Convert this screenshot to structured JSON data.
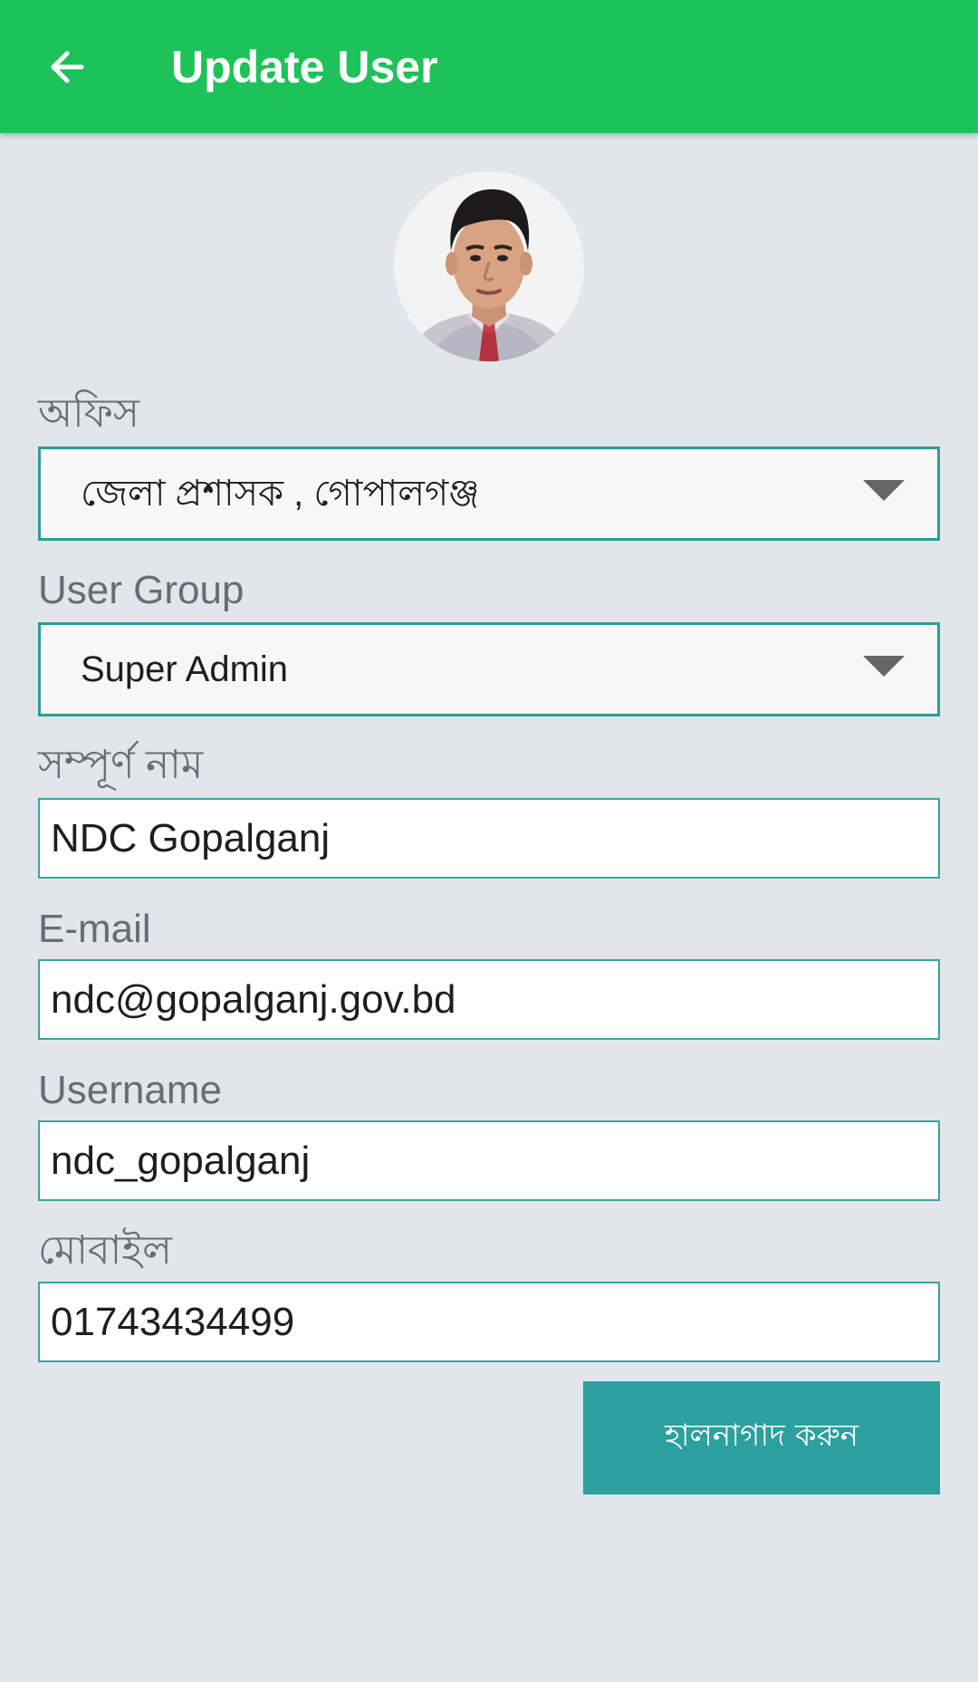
{
  "app_bar": {
    "title": "Update User",
    "back_icon": "arrow-left-icon",
    "color": "#1ec25a"
  },
  "profile": {
    "avatar_icon": "user-photo"
  },
  "form": {
    "office": {
      "label": "অফিস",
      "value": "জেলা  প্রশাসক , গোপালগঞ্জ"
    },
    "user_group": {
      "label": "User Group",
      "value": "Super Admin"
    },
    "full_name": {
      "label": "সম্পূর্ণ নাম",
      "value": "NDC Gopalganj"
    },
    "email": {
      "label": "E-mail",
      "value": "ndc@gopalganj.gov.bd"
    },
    "username": {
      "label": "Username",
      "value": "ndc_gopalganj"
    },
    "mobile": {
      "label": "মোবাইল",
      "value": "01743434499"
    },
    "submit_label": "হালনাগাদ করুন"
  },
  "colors": {
    "accent": "#2ba09e",
    "background": "#e3e5ec",
    "field_border": "#2a9d97"
  }
}
